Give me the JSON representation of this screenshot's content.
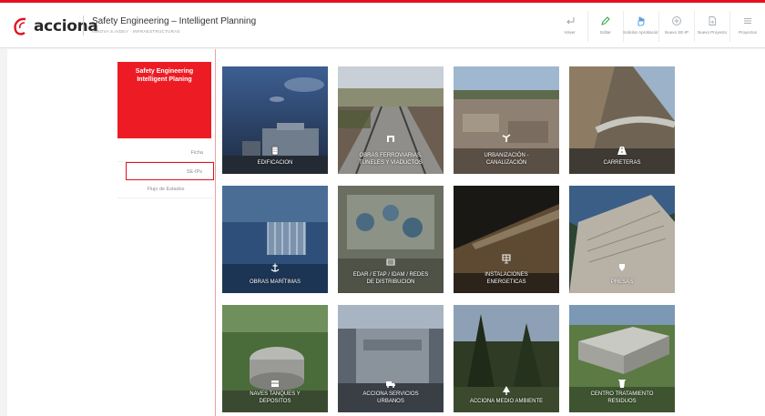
{
  "header": {
    "logo_text": "acciona",
    "app_title": "Safety Engineering – Intelligent Planning",
    "app_subtitle": "INNOVA S.A/DEV · INFRAESTRUCTURAS"
  },
  "toolbar": [
    {
      "label": "Volver",
      "icon": "back-arrow-icon"
    },
    {
      "label": "Editar",
      "icon": "pencil-icon"
    },
    {
      "label": "Solicitar Aprobación",
      "icon": "hand-approve-icon"
    },
    {
      "label": "Nuevo SE-IP",
      "icon": "plus-circle-icon"
    },
    {
      "label": "Nuevo Proyecto",
      "icon": "new-document-icon"
    },
    {
      "label": "Proyectos",
      "icon": "list-icon"
    }
  ],
  "sidebar": {
    "panel_title": "Safety Engineering\nIntelligent Planing",
    "items": [
      {
        "label": "Ficha"
      },
      {
        "label": "SE-IPs"
      },
      {
        "label": "Flujo de Estados"
      }
    ]
  },
  "categories": [
    {
      "label": "EDIFICACION",
      "icon": "building-icon"
    },
    {
      "label": "OBRAS FERROVIARIAS,\nTUNELES Y VIADUCTOS",
      "icon": "tunnel-icon"
    },
    {
      "label": "URBANIZACIÓN -\nCANALIZACIÓN",
      "icon": "pipe-icon"
    },
    {
      "label": "CARRETERAS",
      "icon": "road-icon"
    },
    {
      "label": "OBRAS MARÍTIMAS",
      "icon": "anchor-icon"
    },
    {
      "label": "EDAR / ETAP / IDAM / REDES\nDE DISTRIBUCION",
      "icon": "water-plant-icon"
    },
    {
      "label": "INSTALACIONES\nENERGETICAS",
      "icon": "solar-panel-icon"
    },
    {
      "label": "PRESAS",
      "icon": "dam-icon"
    },
    {
      "label": "NAVES TANQUES Y\nDEPOSITOS",
      "icon": "tank-icon"
    },
    {
      "label": "ACCIONA SERVICIOS\nURBANOS",
      "icon": "truck-icon"
    },
    {
      "label": "ACCIONA MEDIO AMBIENTE",
      "icon": "tree-icon"
    },
    {
      "label": "CENTRO TRATAMIENTO\nRESIDUOS",
      "icon": "waste-bin-icon"
    }
  ],
  "colors": {
    "brand_red": "#e3101f",
    "panel_red": "#ed1c24"
  }
}
